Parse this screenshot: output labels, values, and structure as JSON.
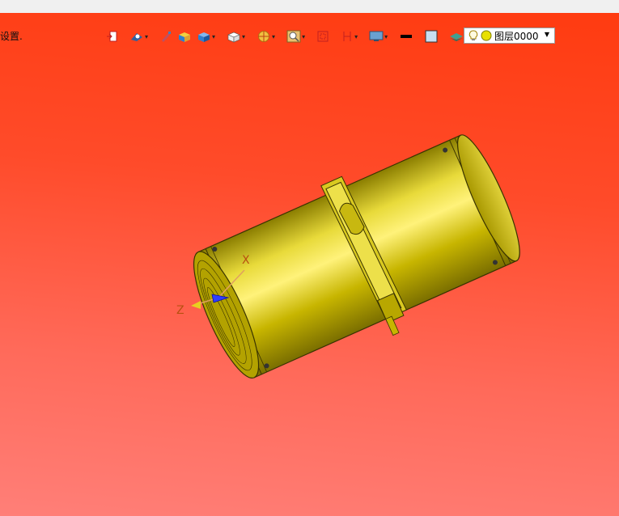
{
  "viewport": {
    "side_label": "设置.",
    "axis_x_label": "X",
    "axis_z_label": "Z"
  },
  "toolbar": {
    "buttons": [
      {
        "name": "exit-icon",
        "has_dropdown": false
      },
      {
        "name": "view-orient-icon",
        "has_dropdown": true
      },
      {
        "name": "pen-icon",
        "has_dropdown": false
      },
      {
        "name": "shaded-box-icon",
        "has_dropdown": false
      },
      {
        "name": "blue-box-icon",
        "has_dropdown": true
      },
      {
        "name": "white-cube-icon",
        "has_dropdown": true
      },
      {
        "name": "section-icon",
        "has_dropdown": true
      },
      {
        "name": "zoom-icon",
        "has_dropdown": true
      },
      {
        "name": "fit-icon",
        "has_dropdown": false
      },
      {
        "name": "clip-icon",
        "has_dropdown": true
      },
      {
        "name": "display-icon",
        "has_dropdown": true
      },
      {
        "name": "line-color-icon",
        "has_dropdown": false
      },
      {
        "name": "fill-color-icon",
        "has_dropdown": false
      },
      {
        "name": "layer-stack-icon",
        "has_dropdown": true
      }
    ]
  },
  "layer_selector": {
    "value": "图层0000"
  },
  "colors": {
    "model": "#c7b500",
    "background_top": "#ff3b10",
    "background_bottom": "#ff7f78"
  }
}
